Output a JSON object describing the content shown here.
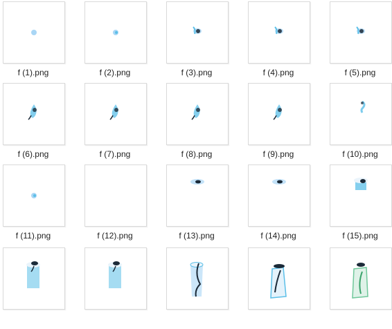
{
  "files": [
    {
      "name": "f (1).png",
      "art": "art-dot"
    },
    {
      "name": "f (2).png",
      "art": "art-blue-orb"
    },
    {
      "name": "f (3).png",
      "art": "art-blue-wisp"
    },
    {
      "name": "f (4).png",
      "art": "art-blue-wisp"
    },
    {
      "name": "f (5).png",
      "art": "art-blue-wisp"
    },
    {
      "name": "f (6).png",
      "art": "art-blue-flame"
    },
    {
      "name": "f (7).png",
      "art": "art-blue-flame"
    },
    {
      "name": "f (8).png",
      "art": "art-blue-flame"
    },
    {
      "name": "f (9).png",
      "art": "art-blue-flame"
    },
    {
      "name": "f (10).png",
      "art": "art-blue-hook"
    },
    {
      "name": "f (11).png",
      "art": "art-blue-orb"
    },
    {
      "name": "f (12).png",
      "art": "art-empty"
    },
    {
      "name": "f (13).png",
      "art": "art-eye"
    },
    {
      "name": "f (14).png",
      "art": "art-eye"
    },
    {
      "name": "f (15).png",
      "art": "art-eye-drip"
    },
    {
      "name": "",
      "art": "art-figure-short"
    },
    {
      "name": "",
      "art": "art-figure-short"
    },
    {
      "name": "",
      "art": "art-figure-tall"
    },
    {
      "name": "",
      "art": "art-bottle"
    },
    {
      "name": "",
      "art": "art-bottle-green"
    }
  ],
  "colors": {
    "thumb_border": "#d9d9d9",
    "accent_blue": "#5bbfe8",
    "accent_light_blue": "#a9d6f5",
    "dark_ink": "#1b2a38"
  }
}
